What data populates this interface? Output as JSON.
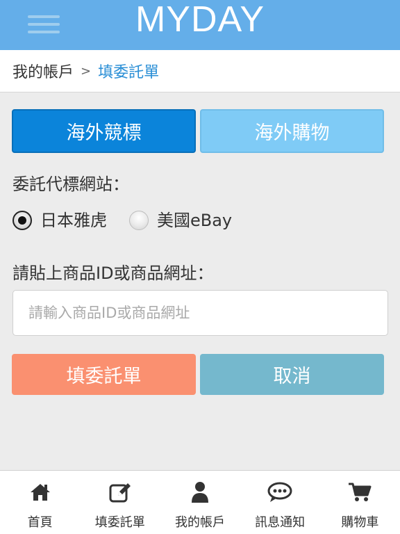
{
  "header": {
    "brand": "MYDAY",
    "menu_icon": "hamburger-icon"
  },
  "breadcrumb": {
    "root": "我的帳戶",
    "separator": ">",
    "current": "填委託單"
  },
  "tabs": [
    {
      "label": "海外競標",
      "active": true
    },
    {
      "label": "海外購物",
      "active": false
    }
  ],
  "form": {
    "site_label": "委託代標網站：",
    "site_options": [
      {
        "label": "日本雅虎",
        "selected": true
      },
      {
        "label": "美國eBay",
        "selected": false
      }
    ],
    "id_label": "請貼上商品ID或商品網址：",
    "id_input": {
      "value": "",
      "placeholder": "請輸入商品ID或商品網址"
    },
    "submit_label": "填委託單",
    "cancel_label": "取消"
  },
  "bottom_nav": [
    {
      "label": "首頁",
      "icon": "home-icon"
    },
    {
      "label": "填委託單",
      "icon": "edit-icon"
    },
    {
      "label": "我的帳戶",
      "icon": "user-icon"
    },
    {
      "label": "訊息通知",
      "icon": "chat-icon"
    },
    {
      "label": "購物車",
      "icon": "cart-icon"
    }
  ],
  "colors": {
    "header": "#64aee9",
    "tab_active": "#0b84da",
    "tab_inactive": "#7fcbf6",
    "submit": "#fa9070",
    "cancel": "#75b8cd",
    "breadcrumb_current": "#2b8fd6"
  }
}
